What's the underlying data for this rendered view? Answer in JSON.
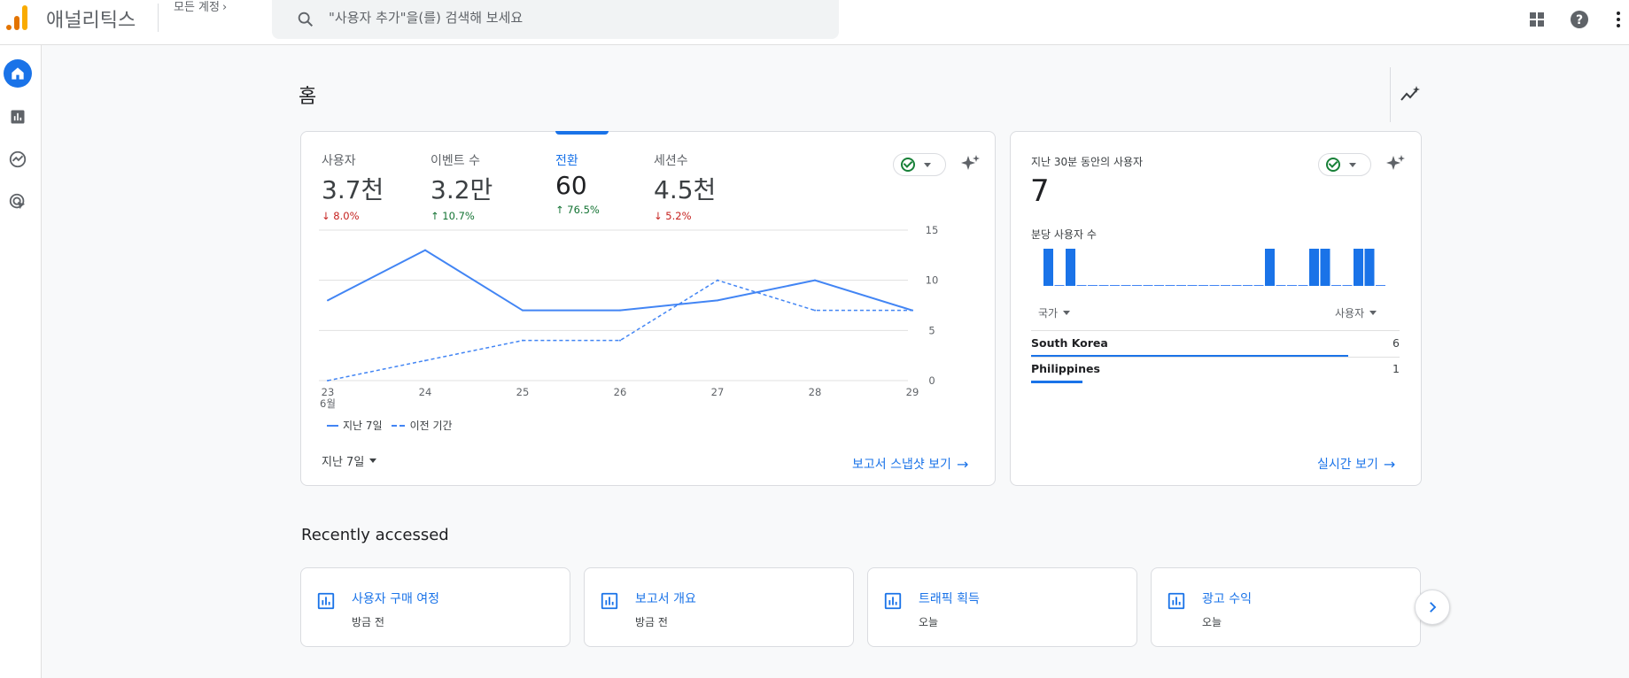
{
  "header": {
    "app_title": "애널리틱스",
    "account_label": "모든 계정",
    "search_placeholder": "\"사용자 추가\"을(를) 검색해 보세요"
  },
  "page": {
    "title": "홈"
  },
  "metrics": [
    {
      "label": "사용자",
      "value": "3.7천",
      "delta": "8.0%",
      "direction": "down"
    },
    {
      "label": "이벤트 수",
      "value": "3.2만",
      "delta": "10.7%",
      "direction": "up"
    },
    {
      "label": "전환",
      "value": "60",
      "delta": "76.5%",
      "direction": "up",
      "selected": true
    },
    {
      "label": "세션수",
      "value": "4.5천",
      "delta": "5.2%",
      "direction": "down"
    }
  ],
  "chart_data": {
    "type": "line",
    "x": [
      "23",
      "24",
      "25",
      "26",
      "27",
      "28",
      "29"
    ],
    "x_sublabel_first": "6월",
    "y_ticks": [
      "15",
      "10",
      "5",
      "0"
    ],
    "ylim": [
      0,
      15
    ],
    "grid": true,
    "series": [
      {
        "name": "지난 7일",
        "style": "solid",
        "values": [
          8,
          13,
          7,
          7,
          8,
          10,
          7
        ]
      },
      {
        "name": "이전 기간",
        "style": "dashed",
        "values": [
          0,
          2,
          4,
          4,
          10,
          7,
          7
        ]
      }
    ]
  },
  "main_card": {
    "date_range": "지난 7일",
    "snapshot_link": "보고서 스냅샷 보기"
  },
  "realtime": {
    "title": "지난 30분 동안의 사용자",
    "value": "7",
    "per_minute_label": "분당 사용자 수",
    "per_minute_values": [
      1,
      0,
      1,
      0,
      0,
      0,
      0,
      0,
      0,
      0,
      0,
      0,
      0,
      0,
      0,
      0,
      0,
      0,
      0,
      0,
      1,
      0,
      0,
      0,
      1,
      1,
      0,
      0,
      1,
      1,
      0
    ],
    "col_country": "국가",
    "col_users": "사용자",
    "rows": [
      {
        "country": "South Korea",
        "users": "6",
        "share": 0.86
      },
      {
        "country": "Philippines",
        "users": "1",
        "share": 0.14
      }
    ],
    "realtime_link": "실시간 보기"
  },
  "recent": {
    "title": "Recently accessed",
    "items": [
      {
        "title": "사용자 구매 여정",
        "time": "방금 전"
      },
      {
        "title": "보고서 개요",
        "time": "방금 전"
      },
      {
        "title": "트래픽 획득",
        "time": "오늘"
      },
      {
        "title": "광고 수익",
        "time": "오늘"
      }
    ]
  },
  "colors": {
    "accent": "#1a73e8",
    "up": "#137333",
    "down": "#c5221f",
    "line": "#4285f4"
  }
}
